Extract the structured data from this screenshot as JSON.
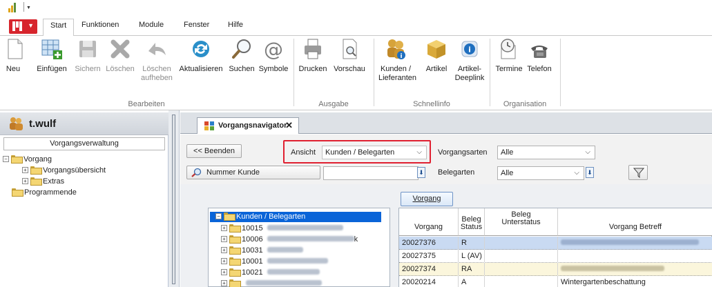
{
  "app": {
    "menu_tabs": [
      "Start",
      "Funktionen",
      "Module",
      "Fenster",
      "Hilfe"
    ]
  },
  "ribbon": {
    "groups": {
      "bearbeiten": "Bearbeiten",
      "ausgabe": "Ausgabe",
      "schnellinfo": "Schnellinfo",
      "organisation": "Organisation"
    },
    "buttons": {
      "neu": "Neu",
      "einfuegen": "Einfügen",
      "sichern": "Sichern",
      "loeschen": "Löschen",
      "loeschen_aufheben_1": "Löschen",
      "loeschen_aufheben_2": "aufheben",
      "aktualisieren": "Aktualisieren",
      "suchen": "Suchen",
      "symbole": "Symbole",
      "drucken": "Drucken",
      "vorschau": "Vorschau",
      "kunden_1": "Kunden /",
      "kunden_2": "Lieferanten",
      "artikel": "Artikel",
      "artikel_deeplink_1": "Artikel-",
      "artikel_deeplink_2": "Deeplink",
      "termine": "Termine",
      "telefon": "Telefon"
    }
  },
  "sidebar": {
    "user": "t.wulf",
    "section": "Vorgangsverwaltung",
    "tree": {
      "vorgang": "Vorgang",
      "uebersicht": "Vorgangsübersicht",
      "extras": "Extras",
      "programmende": "Programmende"
    }
  },
  "document": {
    "tab_title": "Vorgangsnavigator",
    "beenden": "<< Beenden",
    "ansicht_label": "Ansicht",
    "ansicht_value": "Kunden / Belegarten",
    "vorgangsarten_label": "Vorgangsarten",
    "vorgangsarten_value": "Alle",
    "nummer_kunde": "Nummer Kunde",
    "belegarten_label": "Belegarten",
    "belegarten_value": "Alle",
    "vorgang_button": "Vorgang"
  },
  "tree_pane": {
    "root": "Kunden / Belegarten",
    "items": [
      "10015",
      "10006",
      "10031",
      "10001",
      "10021"
    ],
    "partial_suffix": "k"
  },
  "grid": {
    "headers": {
      "vorgang": "Vorgang",
      "beleg_status_1": "Beleg",
      "beleg_status_2": "Status",
      "beleg_unterstatus_1": "Beleg",
      "beleg_unterstatus_2": "Unterstatus",
      "betreff": "Vorgang Betreff"
    },
    "rows": [
      {
        "vorgang": "20027376",
        "status": "R",
        "betreff": ""
      },
      {
        "vorgang": "20027375",
        "status": "L (AV)",
        "betreff": ""
      },
      {
        "vorgang": "20027374",
        "status": "RA",
        "betreff": ""
      },
      {
        "vorgang": "20020214",
        "status": "A",
        "betreff": "Wintergartenbeschattung"
      }
    ]
  }
}
